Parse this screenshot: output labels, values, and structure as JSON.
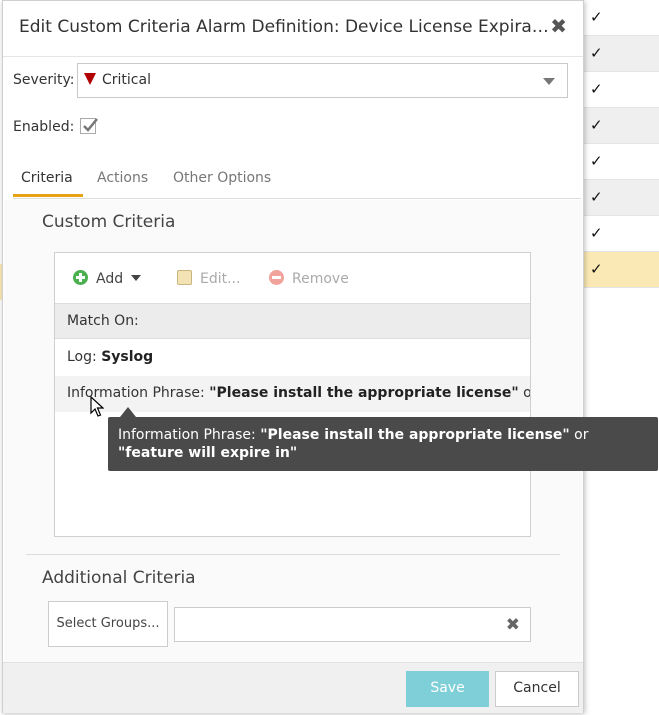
{
  "dialog": {
    "title": "Edit Custom Criteria Alarm Definition: Device License Expiratio...",
    "close_icon": "close-icon"
  },
  "severity": {
    "label": "Severity:",
    "value": "Critical",
    "icon": "critical-triangle-icon",
    "color": "#b00000"
  },
  "enabled": {
    "label": "Enabled:",
    "checked": true
  },
  "tabs": [
    {
      "label": "Criteria",
      "active": true
    },
    {
      "label": "Actions",
      "active": false
    },
    {
      "label": "Other Options",
      "active": false
    }
  ],
  "custom_criteria": {
    "title": "Custom Criteria",
    "toolbar": {
      "add": "Add",
      "edit": "Edit...",
      "remove": "Remove"
    },
    "header": "Match On:",
    "log": {
      "label": "Log: ",
      "value": "Syslog"
    },
    "phrase": {
      "label": "Information Phrase: ",
      "value": "\"Please install the appropriate license\"",
      "suffix": " or ..."
    }
  },
  "tooltip": {
    "label": "Information Phrase: ",
    "value1": "\"Please install the appropriate license\"",
    "or": " or ",
    "value2": "\"feature will expire in\""
  },
  "additional_criteria": {
    "title": "Additional Criteria",
    "select_groups": "Select Groups...",
    "groups_value": ""
  },
  "footer": {
    "save": "Save",
    "cancel": "Cancel"
  },
  "background": {
    "checkmark": "✓",
    "rows": 8,
    "highlighted_row": 8
  },
  "colors": {
    "accent": "#e8a317",
    "save_button": "#7fcfd8",
    "add_icon": "#4caf50",
    "tooltip_bg": "#4a4a4a"
  }
}
